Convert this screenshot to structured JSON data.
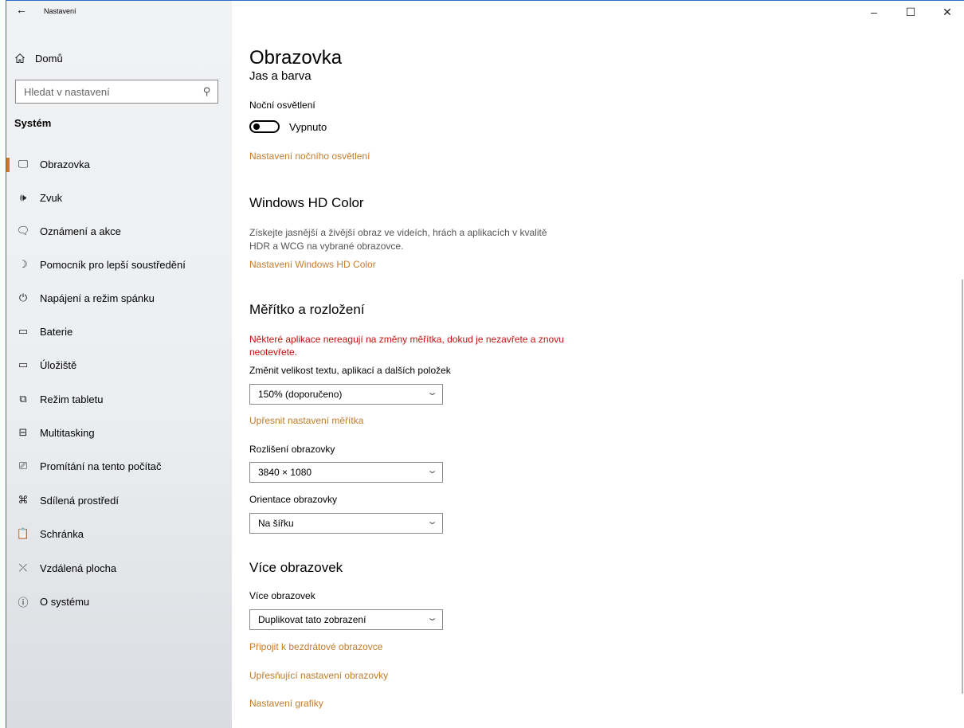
{
  "titlebar": {
    "back_icon": "←",
    "app_title": "Nastavení",
    "minimize": "–",
    "maximize": "☐",
    "close": "✕"
  },
  "sidebar": {
    "home_label": "Domů",
    "search_placeholder": "Hledat v nastavení",
    "section_title": "Systém",
    "items": [
      {
        "label": "Obrazovka",
        "icon": "monitor-icon",
        "glyph": "🖵",
        "active": true
      },
      {
        "label": "Zvuk",
        "icon": "speaker-icon",
        "glyph": "🕪"
      },
      {
        "label": "Oznámení a akce",
        "icon": "message-icon",
        "glyph": "🗨"
      },
      {
        "label": "Pomocník pro lepší soustředění",
        "icon": "moon-icon",
        "glyph": "☽"
      },
      {
        "label": "Napájení a režim spánku",
        "icon": "power-icon",
        "glyph": "⏻"
      },
      {
        "label": "Baterie",
        "icon": "battery-icon",
        "glyph": "▭"
      },
      {
        "label": "Úložiště",
        "icon": "storage-icon",
        "glyph": "▭"
      },
      {
        "label": "Režim tabletu",
        "icon": "tablet-icon",
        "glyph": "⧉"
      },
      {
        "label": "Multitasking",
        "icon": "multitasking-icon",
        "glyph": "⊟"
      },
      {
        "label": "Promítání na tento počítač",
        "icon": "projecting-icon",
        "glyph": "⎚"
      },
      {
        "label": "Sdílená prostředí",
        "icon": "shared-experiences-icon",
        "glyph": "⌘"
      },
      {
        "label": "Schránka",
        "icon": "clipboard-icon",
        "glyph": "📋"
      },
      {
        "label": "Vzdálená plocha",
        "icon": "remote-desktop-icon",
        "glyph": "⤫"
      },
      {
        "label": "O systému",
        "icon": "info-icon",
        "glyph": "ⓘ"
      }
    ]
  },
  "main": {
    "page_title": "Obrazovka",
    "brightness_heading": "Jas a barva",
    "night_light_label": "Noční osvětlení",
    "night_light_state": "Vypnuto",
    "night_light_settings_link": "Nastavení nočního osvětlení",
    "hd_color_heading": "Windows HD Color",
    "hd_color_desc": "Získejte jasnější a živější obraz ve videích, hrách a aplikacích v kvalitě HDR a WCG na vybrané obrazovce.",
    "hd_color_link": "Nastavení Windows HD Color",
    "scale_heading": "Měřítko a rozložení",
    "scale_warning": "Některé aplikace nereagují na změny měřítka, dokud je nezavřete a znovu neotevřete.",
    "scale_label": "Změnit velikost textu, aplikací a dalších položek",
    "scale_value": "150% (doporučeno)",
    "scale_advanced_link": "Upřesnit nastavení měřítka",
    "resolution_label": "Rozlišení obrazovky",
    "resolution_value": "3840 × 1080",
    "orientation_label": "Orientace obrazovky",
    "orientation_value": "Na šířku",
    "multi_heading": "Více obrazovek",
    "multi_label": "Více obrazovek",
    "multi_value": "Duplikovat tato zobrazení",
    "wireless_link": "Připojit k bezdrátové obrazovce",
    "advanced_display_link": "Upřesňující nastavení obrazovky",
    "graphics_link": "Nastavení grafiky"
  },
  "colors": {
    "accent": "#c57c2b",
    "warning": "#c80f0f"
  }
}
